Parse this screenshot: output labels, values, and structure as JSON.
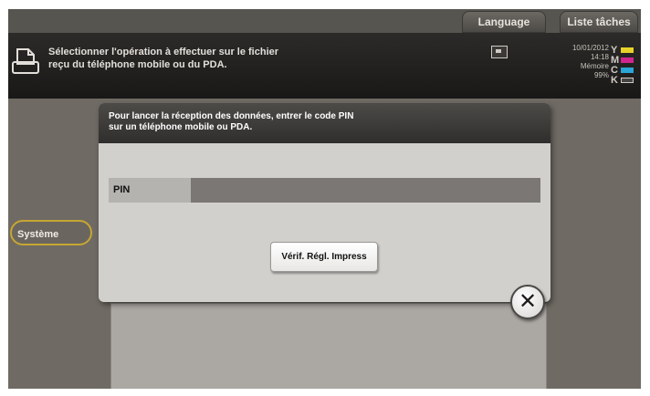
{
  "topbar": {
    "language_label": "Language",
    "jobs_label": "Liste tâches"
  },
  "message_bar": {
    "text": "Sélectionner l'opération à effectuer sur le fichier\nreçu du téléphone mobile ou du PDA.",
    "date": "10/01/2012",
    "time": "14:18",
    "memory_label": "Mémoire",
    "memory_value": "99%",
    "toner": [
      {
        "letter": "Y",
        "color": "#e8d22a"
      },
      {
        "letter": "M",
        "color": "#d0258f"
      },
      {
        "letter": "C",
        "color": "#2aa5d8"
      },
      {
        "letter": "K",
        "color": "#444444"
      }
    ]
  },
  "sidebar": {
    "systeme_label": "Système"
  },
  "dialog": {
    "message": "Pour lancer la réception des données, entrer le code PIN\nsur un téléphone mobile ou PDA.",
    "pin_label": "PIN",
    "pin_value": "",
    "verify_button": "Vérif. Régl. Impress",
    "close_symbol": "✕"
  }
}
